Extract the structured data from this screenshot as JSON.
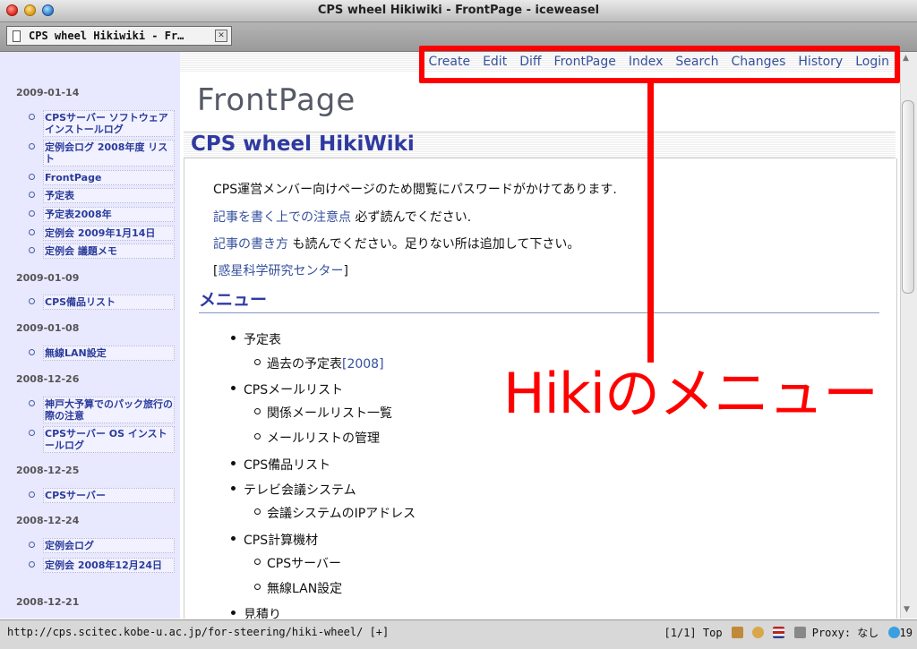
{
  "window": {
    "title": "CPS wheel Hikiwiki - FrontPage - iceweasel"
  },
  "tab": {
    "label": "CPS wheel Hikiwiki - Fr…",
    "close_glyph": "✕"
  },
  "nav": {
    "create": "Create",
    "edit": "Edit",
    "diff": "Diff",
    "frontpage": "FrontPage",
    "index": "Index",
    "search": "Search",
    "changes": "Changes",
    "history": "History",
    "login": "Login"
  },
  "page": {
    "title": "FrontPage"
  },
  "section": {
    "title": "CPS wheel HikiWiki"
  },
  "content": {
    "intro": "CPS運営メンバー向けページのため閲覧にパスワードがかけてあります.",
    "line2_link": "記事を書く上での注意点",
    "line2_text": " 必ず読んでください.",
    "line3_link": "記事の書き方",
    "line3_text": " も読んでください。足りない所は追加して下さい。",
    "line4_open": "[",
    "line4_link": "惑星科学研究センター",
    "line4_close": "]"
  },
  "menu": {
    "heading": "メニュー",
    "item1": "予定表",
    "item1_sub_text": "過去の予定表",
    "item1_sub_link": "[2008]",
    "item2": "CPSメールリスト",
    "item2_sub1": "関係メールリスト一覧",
    "item2_sub2": "メールリストの管理",
    "item3": "CPS備品リスト",
    "item4": "テレビ会議システム",
    "item4_sub": "会議システムのIPアドレス",
    "item5": "CPS計算機材",
    "item5_sub1": "CPSサーバー",
    "item5_sub2": "無線LAN設定",
    "item6": "見積り"
  },
  "sidebar": {
    "d1": "2009-01-14",
    "d1_i1": "CPSサーバー ソフトウェア インストールログ",
    "d1_i2": "定例会ログ 2008年度 リスト",
    "d1_i3": "FrontPage",
    "d1_i4": "予定表",
    "d1_i5": "予定表2008年",
    "d1_i6": "定例会 2009年1月14日",
    "d1_i7": "定例会 議題メモ",
    "d2": "2009-01-09",
    "d2_i1": "CPS備品リスト",
    "d3": "2009-01-08",
    "d3_i1": "無線LAN設定",
    "d4": "2008-12-26",
    "d4_i1": "神戸大予算でのパック旅行の際の注意",
    "d4_i2": "CPSサーバー OS インストールログ",
    "d5": "2008-12-25",
    "d5_i1": "CPSサーバー",
    "d6": "2008-12-24",
    "d6_i1": "定例会ログ",
    "d6_i2": "定例会 2008年12月24日",
    "d7": "2008-12-21"
  },
  "status": {
    "url": "http://cps.scitec.kobe-u.ac.jp/for-steering/hiki-wheel/ [+]",
    "position": "[1/1] Top",
    "proxy": "Proxy: なし",
    "count": "19"
  },
  "annotation": {
    "label": "Hikiのメニュー",
    "color": "#ff0000"
  },
  "colors": {
    "link": "#35519c",
    "heading": "#2f3aa0",
    "sidebar_bg": "#e8e8ff"
  }
}
